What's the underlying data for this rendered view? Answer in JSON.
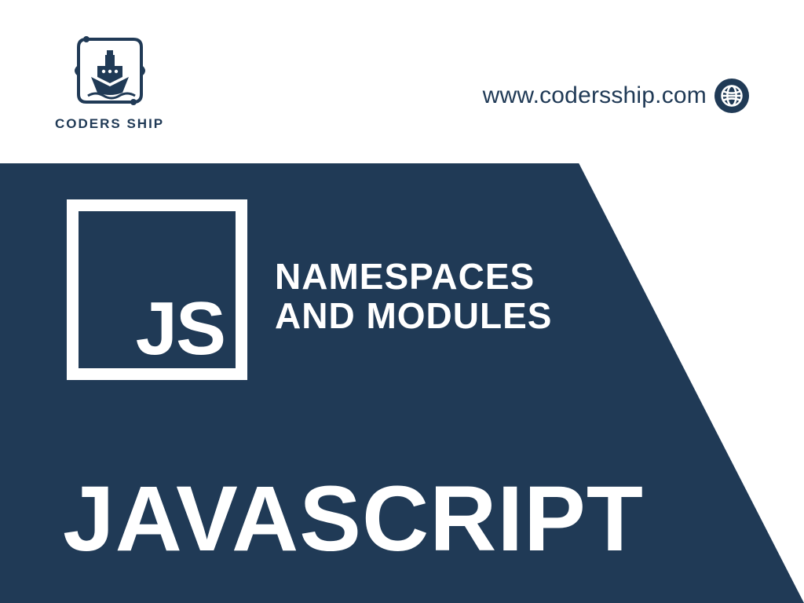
{
  "header": {
    "logo_name": "CODERS SHIP",
    "url": "www.codersship.com"
  },
  "hero": {
    "badge": "JS",
    "subtitle_line1": "NAMESPACES",
    "subtitle_line2": "AND MODULES",
    "title": "JAVASCRIPT"
  },
  "colors": {
    "brand": "#203a56",
    "bg": "#ffffff",
    "fg_on_brand": "#ffffff"
  }
}
